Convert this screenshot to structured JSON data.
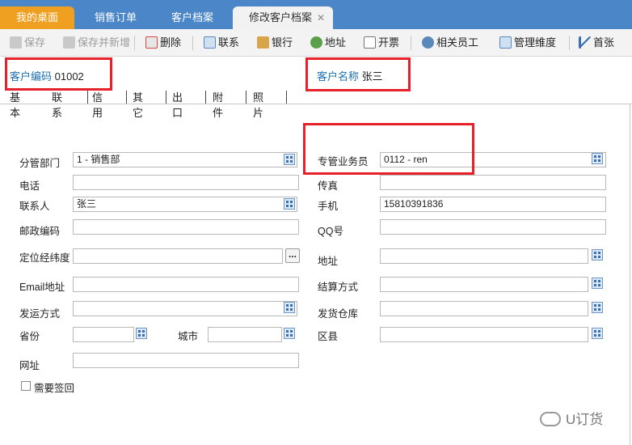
{
  "tabs": {
    "home": "我的桌面",
    "sales_order": "销售订单",
    "customer_file": "客户档案",
    "edit_customer": "修改客户档案",
    "close_glyph": "✕"
  },
  "toolbar": {
    "save": "保存",
    "save_new": "保存并新增",
    "delete": "删除",
    "contact": "联系",
    "bank": "银行",
    "address": "地址",
    "invoice": "开票",
    "staff": "相关员工",
    "dimension": "管理维度",
    "first": "首张"
  },
  "header": {
    "code_label": "客户编码",
    "code_value": "01002",
    "name_label": "客户名称",
    "name_value": "张三"
  },
  "form_tabs": [
    "基本",
    "联系",
    "信用",
    "其它",
    "出口",
    "附件",
    "照片"
  ],
  "form": {
    "dept_label": "分管部门",
    "dept_value": "1 - 销售部",
    "sales_label": "专管业务员",
    "sales_value": "0112 - ren",
    "phone_label": "电话",
    "phone_value": "",
    "fax_label": "传真",
    "fax_value": "",
    "contact_label": "联系人",
    "contact_value": "张三",
    "mobile_label": "手机",
    "mobile_value": "15810391836",
    "zip_label": "邮政编码",
    "zip_value": "",
    "qq_label": "QQ号",
    "qq_value": "",
    "geo_label": "定位经纬度",
    "geo_value": "",
    "geo_btn": "...",
    "addr_label": "地址",
    "addr_value": "",
    "email_label": "Email地址",
    "email_value": "",
    "settle_label": "结算方式",
    "settle_value": "",
    "ship_label": "发运方式",
    "ship_value": "",
    "wh_label": "发货仓库",
    "wh_value": "",
    "prov_label": "省份",
    "prov_value": "",
    "city_label": "城市",
    "city_value": "",
    "district_label": "区县",
    "district_value": "",
    "web_label": "网址",
    "web_value": "",
    "sign_label": "需要签回"
  },
  "watermark": "U订货",
  "colors": {
    "tabbar": "#4a86c8",
    "home_tab": "#f0a020",
    "highlight": "#e8202a",
    "label_blue": "#1a6fb5"
  }
}
